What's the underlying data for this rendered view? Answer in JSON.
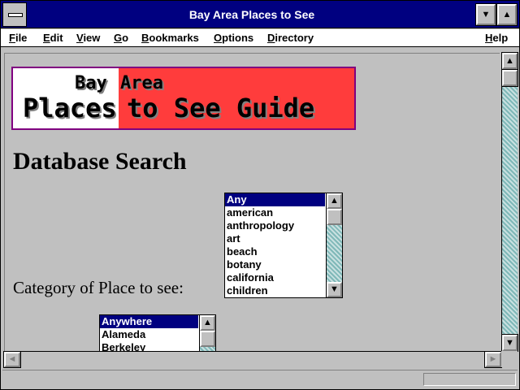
{
  "window": {
    "title": "Bay Area Places to See"
  },
  "menu": [
    "File",
    "Edit",
    "View",
    "Go",
    "Bookmarks",
    "Options",
    "Directory",
    "Help"
  ],
  "banner": {
    "bay": "Bay",
    "area": "Area",
    "places": "Places",
    "to_see": "to See Guide"
  },
  "page": {
    "heading": "Database Search",
    "category_label": "Category of Place to see:"
  },
  "category_list": {
    "selected": "Any",
    "options": [
      "Any",
      "american",
      "anthropology",
      "art",
      "beach",
      "botany",
      "california",
      "children"
    ]
  },
  "location_list": {
    "selected": "Anywhere",
    "options": [
      "Anywhere",
      "Alameda",
      "Berkeley"
    ]
  },
  "icons": {
    "up": "▲",
    "down": "▼",
    "left": "◄",
    "right": "►"
  },
  "colors": {
    "titlebar": "#000080",
    "banner_red": "#ff3c3c",
    "banner_border": "#800080",
    "selection": "#000080"
  }
}
